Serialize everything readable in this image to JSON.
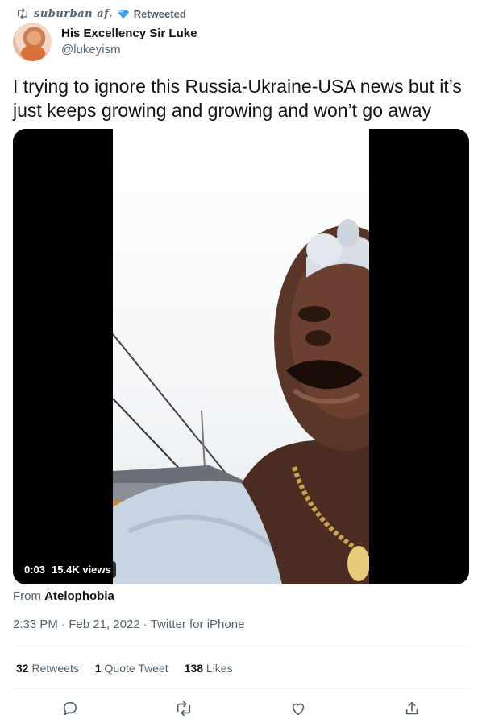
{
  "retweet": {
    "retweeter": "suburban af.",
    "label": "Retweeted"
  },
  "author": {
    "display_name": "His Excellency Sir Luke",
    "handle": "@lukeyism"
  },
  "tweet": {
    "text": "I trying to ignore this Russia-Ukraine-USA news but it’s just keeps growing and growing and won’t go away"
  },
  "media": {
    "duration": "0:03",
    "views": "15.4K views"
  },
  "from": {
    "prefix": "From",
    "source": "Atelophobia"
  },
  "meta": {
    "time": "2:33 PM",
    "date": "Feb 21, 2022",
    "client": "Twitter for iPhone",
    "separator": "·"
  },
  "stats": {
    "retweets_count": "32",
    "retweets_label": "Retweets",
    "quotes_count": "1",
    "quotes_label": "Quote Tweet",
    "likes_count": "138",
    "likes_label": "Likes"
  },
  "icons": {
    "retweet": "retweet-icon",
    "verified_diamond": "diamond-emoji-icon",
    "reply": "reply-icon",
    "like": "heart-icon",
    "share": "share-icon"
  },
  "colors": {
    "text": "#0f1419",
    "secondary": "#536471",
    "divider": "#eff3f4"
  }
}
